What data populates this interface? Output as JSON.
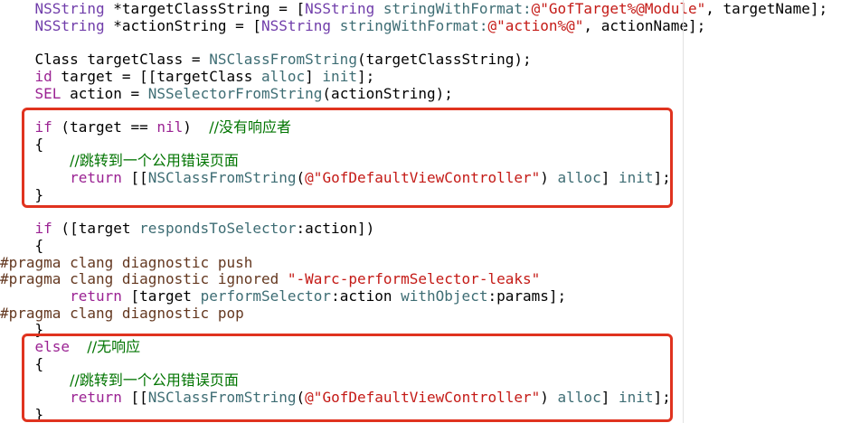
{
  "colors": {
    "plain": "#000000",
    "type": "#703daa",
    "method": "#3e6d74",
    "string": "#c41a16",
    "keyword": "#9b2393",
    "comment": "#007400",
    "preprocessor": "#643820",
    "highlight": "#e0331f"
  },
  "lines": [
    {
      "tokens": [
        {
          "t": "    ",
          "c": "plain"
        },
        {
          "t": "NSString",
          "c": "type"
        },
        {
          "t": " *targetClassString = [",
          "c": "plain"
        },
        {
          "t": "NSString",
          "c": "type"
        },
        {
          "t": " ",
          "c": "plain"
        },
        {
          "t": "stringWithFormat:",
          "c": "method"
        },
        {
          "t": "@\"GofTarget%@Module\"",
          "c": "string"
        },
        {
          "t": ", targetName];",
          "c": "plain"
        }
      ]
    },
    {
      "tokens": [
        {
          "t": "    ",
          "c": "plain"
        },
        {
          "t": "NSString",
          "c": "type"
        },
        {
          "t": " *actionString = [",
          "c": "plain"
        },
        {
          "t": "NSString",
          "c": "type"
        },
        {
          "t": " ",
          "c": "plain"
        },
        {
          "t": "stringWithFormat:",
          "c": "method"
        },
        {
          "t": "@\"action%@\"",
          "c": "string"
        },
        {
          "t": ", actionName];",
          "c": "plain"
        }
      ]
    },
    {
      "tokens": []
    },
    {
      "tokens": [
        {
          "t": "    Class targetClass = ",
          "c": "plain"
        },
        {
          "t": "NSClassFromString",
          "c": "method"
        },
        {
          "t": "(targetClassString);",
          "c": "plain"
        }
      ]
    },
    {
      "tokens": [
        {
          "t": "    ",
          "c": "plain"
        },
        {
          "t": "id",
          "c": "keyword"
        },
        {
          "t": " target = [[targetClass ",
          "c": "plain"
        },
        {
          "t": "alloc",
          "c": "method"
        },
        {
          "t": "] ",
          "c": "plain"
        },
        {
          "t": "init",
          "c": "method"
        },
        {
          "t": "];",
          "c": "plain"
        }
      ]
    },
    {
      "tokens": [
        {
          "t": "    ",
          "c": "plain"
        },
        {
          "t": "SEL",
          "c": "keyword"
        },
        {
          "t": " action = ",
          "c": "plain"
        },
        {
          "t": "NSSelectorFromString",
          "c": "method"
        },
        {
          "t": "(actionString);",
          "c": "plain"
        }
      ]
    },
    {
      "tokens": []
    },
    {
      "tokens": [
        {
          "t": "    ",
          "c": "plain"
        },
        {
          "t": "if",
          "c": "keyword"
        },
        {
          "t": " (target == ",
          "c": "plain"
        },
        {
          "t": "nil",
          "c": "keyword"
        },
        {
          "t": ")  ",
          "c": "plain"
        },
        {
          "t": "//没有响应者",
          "c": "comment",
          "cjk": true
        }
      ]
    },
    {
      "tokens": [
        {
          "t": "    {",
          "c": "plain"
        }
      ]
    },
    {
      "tokens": [
        {
          "t": "        ",
          "c": "plain"
        },
        {
          "t": "//跳转到一个公用错误页面",
          "c": "comment",
          "cjk": true
        }
      ]
    },
    {
      "tokens": [
        {
          "t": "        ",
          "c": "plain"
        },
        {
          "t": "return",
          "c": "keyword"
        },
        {
          "t": " [[",
          "c": "plain"
        },
        {
          "t": "NSClassFromString",
          "c": "method"
        },
        {
          "t": "(",
          "c": "plain"
        },
        {
          "t": "@\"GofDefaultViewController\"",
          "c": "string"
        },
        {
          "t": ") ",
          "c": "plain"
        },
        {
          "t": "alloc",
          "c": "method"
        },
        {
          "t": "] ",
          "c": "plain"
        },
        {
          "t": "init",
          "c": "method"
        },
        {
          "t": "];",
          "c": "plain"
        }
      ]
    },
    {
      "tokens": [
        {
          "t": "    }",
          "c": "plain"
        }
      ]
    },
    {
      "tokens": []
    },
    {
      "tokens": [
        {
          "t": "    ",
          "c": "plain"
        },
        {
          "t": "if",
          "c": "keyword"
        },
        {
          "t": " ([target ",
          "c": "plain"
        },
        {
          "t": "respondsToSelector",
          "c": "method"
        },
        {
          "t": ":action])",
          "c": "plain"
        }
      ]
    },
    {
      "tokens": [
        {
          "t": "    {",
          "c": "plain"
        }
      ]
    },
    {
      "tokens": [
        {
          "t": "#pragma clang diagnostic push",
          "c": "preprocessor"
        }
      ]
    },
    {
      "tokens": [
        {
          "t": "#pragma clang diagnostic ignored ",
          "c": "preprocessor"
        },
        {
          "t": "\"-Warc-performSelector-leaks\"",
          "c": "string"
        }
      ]
    },
    {
      "tokens": [
        {
          "t": "        ",
          "c": "plain"
        },
        {
          "t": "return",
          "c": "keyword"
        },
        {
          "t": " [target ",
          "c": "plain"
        },
        {
          "t": "performSelector",
          "c": "method"
        },
        {
          "t": ":action ",
          "c": "plain"
        },
        {
          "t": "withObject",
          "c": "method"
        },
        {
          "t": ":params];",
          "c": "plain"
        }
      ]
    },
    {
      "tokens": [
        {
          "t": "#pragma clang diagnostic pop",
          "c": "preprocessor"
        }
      ]
    },
    {
      "tokens": [
        {
          "t": "    }",
          "c": "plain"
        }
      ]
    },
    {
      "tokens": [
        {
          "t": "    ",
          "c": "plain"
        },
        {
          "t": "else",
          "c": "keyword"
        },
        {
          "t": "  ",
          "c": "plain"
        },
        {
          "t": "//无响应",
          "c": "comment",
          "cjk": true
        }
      ]
    },
    {
      "tokens": [
        {
          "t": "    {",
          "c": "plain"
        }
      ]
    },
    {
      "tokens": [
        {
          "t": "        ",
          "c": "plain"
        },
        {
          "t": "//跳转到一个公用错误页面",
          "c": "comment",
          "cjk": true
        }
      ]
    },
    {
      "tokens": [
        {
          "t": "        ",
          "c": "plain"
        },
        {
          "t": "return",
          "c": "keyword"
        },
        {
          "t": " [[",
          "c": "plain"
        },
        {
          "t": "NSClassFromString",
          "c": "method"
        },
        {
          "t": "(",
          "c": "plain"
        },
        {
          "t": "@\"GofDefaultViewController\"",
          "c": "string"
        },
        {
          "t": ") ",
          "c": "plain"
        },
        {
          "t": "alloc",
          "c": "method"
        },
        {
          "t": "] ",
          "c": "plain"
        },
        {
          "t": "init",
          "c": "method"
        },
        {
          "t": "];",
          "c": "plain"
        }
      ]
    },
    {
      "tokens": [
        {
          "t": "    }",
          "c": "plain"
        }
      ]
    }
  ]
}
